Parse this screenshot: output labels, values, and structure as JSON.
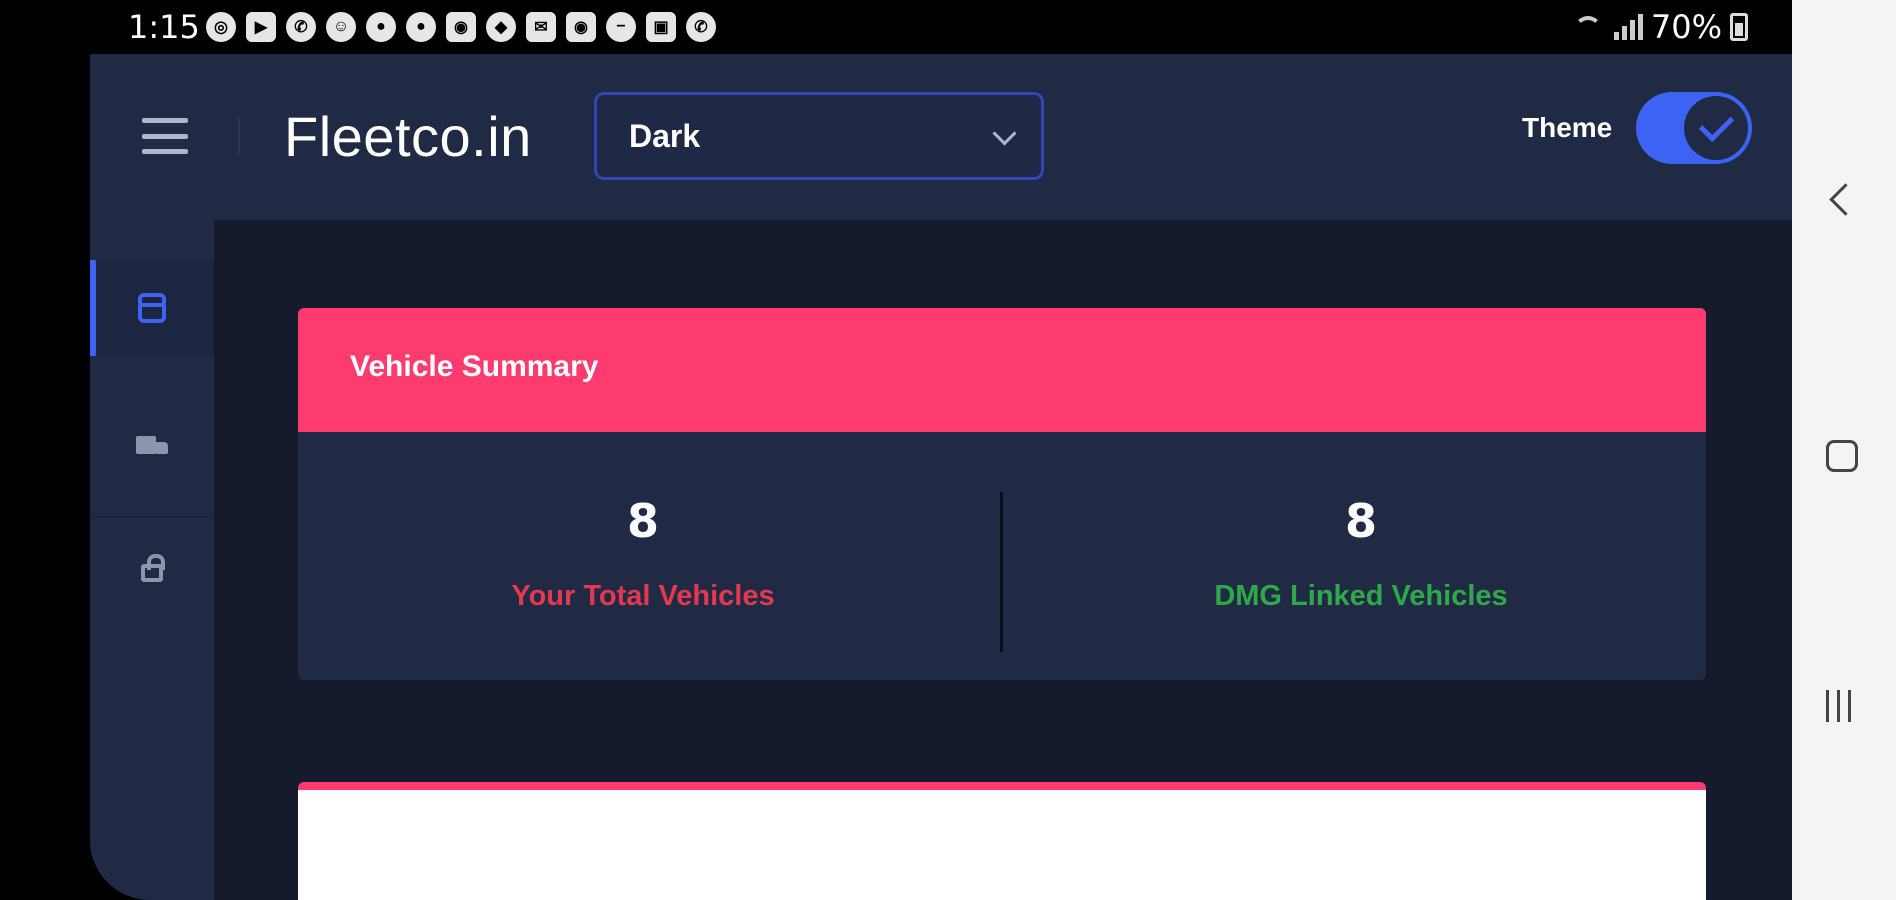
{
  "status_bar": {
    "time": "1:15",
    "battery": "70%",
    "notification_icons": [
      "chrome-icon",
      "youtube-icon",
      "whatsapp-icon",
      "snapchat-icon",
      "reddit-icon",
      "reddit-icon",
      "instagram-icon",
      "maps-icon",
      "mail-icon",
      "instagram-icon",
      "minus-icon",
      "gallery-icon",
      "phone-icon"
    ]
  },
  "header": {
    "logo": "Fleetco.in",
    "theme_select": {
      "value": "Dark"
    },
    "theme_label": "Theme",
    "theme_toggle_on": true,
    "accent": "#3d63f5"
  },
  "sidebar": {
    "items": [
      {
        "icon": "calendar-icon",
        "active": true
      },
      {
        "icon": "truck-icon",
        "active": false
      },
      {
        "icon": "lock-icon",
        "active": false
      }
    ]
  },
  "summary": {
    "title": "Vehicle Summary",
    "header_color": "#fe3b6e",
    "stats": [
      {
        "value": "8",
        "label": "Your Total Vehicles",
        "color": "#e3394f"
      },
      {
        "value": "8",
        "label": "DMG Linked Vehicles",
        "color": "#2fa84a"
      }
    ]
  },
  "nav_bar": {
    "buttons": [
      "back-icon",
      "home-icon",
      "recent-apps-icon"
    ]
  }
}
